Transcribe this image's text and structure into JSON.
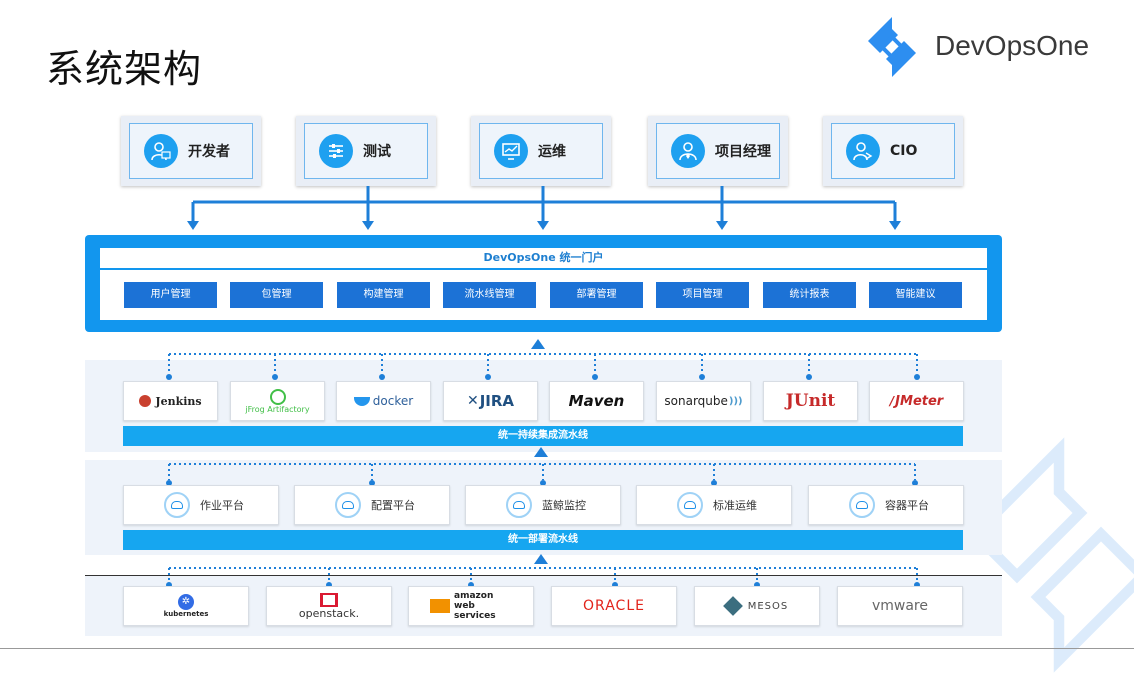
{
  "page_title": "系统架构",
  "brand": {
    "name": "DevOpsOne"
  },
  "roles": [
    {
      "label": "开发者",
      "icon": "developer-icon"
    },
    {
      "label": "测试",
      "icon": "test-settings-icon"
    },
    {
      "label": "运维",
      "icon": "ops-monitor-icon"
    },
    {
      "label": "项目经理",
      "icon": "manager-icon"
    },
    {
      "label": "CIO",
      "icon": "cio-icon"
    }
  ],
  "portal": {
    "title": "DevOpsOne 统一门户",
    "modules": [
      "用户管理",
      "包管理",
      "构建管理",
      "流水线管理",
      "部署管理",
      "项目管理",
      "统计报表",
      "智能建议"
    ]
  },
  "ci": {
    "tools": [
      "Jenkins",
      "jFrog Artifactory",
      "docker",
      "JIRA",
      "Maven",
      "sonarqube",
      "JUnit",
      "JMeter"
    ],
    "bar_label": "统一持续集成流水线"
  },
  "cd": {
    "platforms": [
      "作业平台",
      "配置平台",
      "蓝鲸监控",
      "标准运维",
      "容器平台"
    ],
    "bar_label": "统一部署流水线"
  },
  "infra": [
    "kubernetes",
    "openstack.",
    "amazon web services",
    "ORACLE",
    "MESOS",
    "vmware"
  ],
  "colors": {
    "primary": "#1296ee",
    "button": "#1c72d6",
    "bar": "#16a6f0",
    "band": "#eef3fa",
    "connector": "#1e7fd8"
  }
}
